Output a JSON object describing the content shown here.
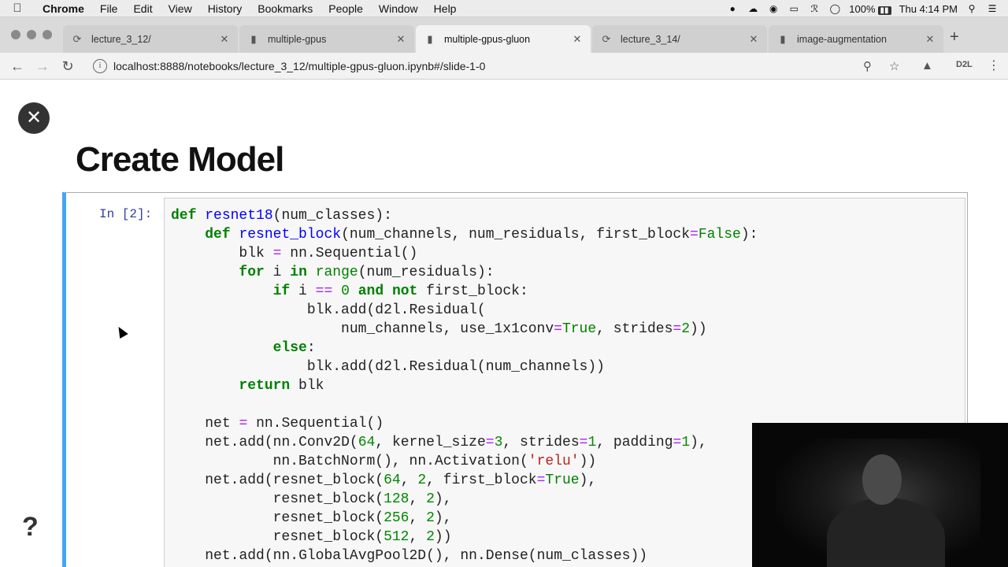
{
  "menubar": {
    "app_name": "Chrome",
    "items": [
      "File",
      "Edit",
      "View",
      "History",
      "Bookmarks",
      "People",
      "Window",
      "Help"
    ],
    "battery": "100%",
    "clock": "Thu 4:14 PM"
  },
  "tabs": [
    {
      "label": "lecture_3_12/",
      "icon": "loading-icon"
    },
    {
      "label": "multiple-gpus",
      "icon": "notebook-icon"
    },
    {
      "label": "multiple-gpus-gluon",
      "icon": "notebook-icon"
    },
    {
      "label": "lecture_3_14/",
      "icon": "loading-icon"
    },
    {
      "label": "image-augmentation",
      "icon": "notebook-icon"
    }
  ],
  "toolbar": {
    "url": "localhost:8888/notebooks/lecture_3_12/multiple-gpus-gluon.ipynb#/slide-1-0",
    "extension_label": "D2L"
  },
  "slide": {
    "title": "Create Model",
    "prompt": "In [2]:"
  },
  "code_lines": [
    "def resnet18(num_classes):",
    "    def resnet_block(num_channels, num_residuals, first_block=False):",
    "        blk = nn.Sequential()",
    "        for i in range(num_residuals):",
    "            if i == 0 and not first_block:",
    "                blk.add(d2l.Residual(",
    "                    num_channels, use_1x1conv=True, strides=2))",
    "            else:",
    "                blk.add(d2l.Residual(num_channels))",
    "        return blk",
    "",
    "    net = nn.Sequential()",
    "    net.add(nn.Conv2D(64, kernel_size=3, strides=1, padding=1),",
    "            nn.BatchNorm(), nn.Activation('relu'))",
    "    net.add(resnet_block(64, 2, first_block=True),",
    "            resnet_block(128, 2),",
    "            resnet_block(256, 2),",
    "            resnet_block(512, 2))",
    "    net.add(nn.GlobalAvgPool2D(), nn.Dense(num_classes))"
  ],
  "colors": {
    "keyword": "#008000",
    "string": "#ba2121",
    "number": "#080",
    "operator": "#aa22ff",
    "prompt": "#303f9f",
    "cell_border": "#42a5f5"
  }
}
